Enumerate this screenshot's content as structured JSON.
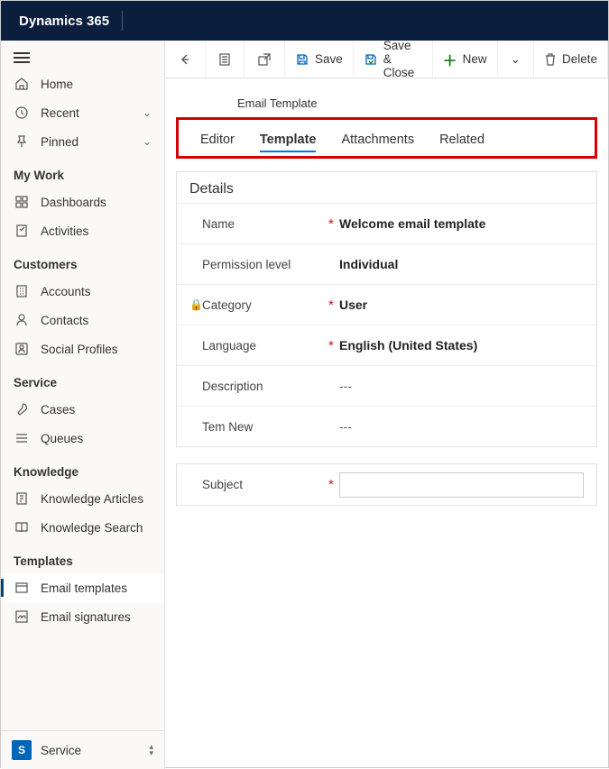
{
  "app_title": "Dynamics 365",
  "nav": {
    "home": "Home",
    "recent": "Recent",
    "pinned": "Pinned",
    "sections": [
      {
        "title": "My Work",
        "items": [
          {
            "key": "dashboards",
            "label": "Dashboards"
          },
          {
            "key": "activities",
            "label": "Activities"
          }
        ]
      },
      {
        "title": "Customers",
        "items": [
          {
            "key": "accounts",
            "label": "Accounts"
          },
          {
            "key": "contacts",
            "label": "Contacts"
          },
          {
            "key": "social",
            "label": "Social Profiles"
          }
        ]
      },
      {
        "title": "Service",
        "items": [
          {
            "key": "cases",
            "label": "Cases"
          },
          {
            "key": "queues",
            "label": "Queues"
          }
        ]
      },
      {
        "title": "Knowledge",
        "items": [
          {
            "key": "karticles",
            "label": "Knowledge Articles"
          },
          {
            "key": "ksearch",
            "label": "Knowledge Search"
          }
        ]
      },
      {
        "title": "Templates",
        "items": [
          {
            "key": "emailtpl",
            "label": "Email templates",
            "active": true
          },
          {
            "key": "emailsig",
            "label": "Email signatures"
          }
        ]
      }
    ]
  },
  "area": {
    "badge": "S",
    "name": "Service"
  },
  "cmd": {
    "save": "Save",
    "saveclose": "Save & Close",
    "new": "New",
    "delete": "Delete"
  },
  "form": {
    "entity": "Email Template",
    "tabs": {
      "editor": "Editor",
      "template": "Template",
      "attachments": "Attachments",
      "related": "Related"
    },
    "details_title": "Details",
    "fields": {
      "name_label": "Name",
      "name_val": "Welcome email template",
      "perm_label": "Permission level",
      "perm_val": "Individual",
      "cat_label": "Category",
      "cat_val": "User",
      "lang_label": "Language",
      "lang_val": "English (United States)",
      "desc_label": "Description",
      "desc_val": "---",
      "temnew_label": "Tem New",
      "temnew_val": "---",
      "subj_label": "Subject",
      "subj_val": ""
    }
  },
  "req_mark": "*"
}
